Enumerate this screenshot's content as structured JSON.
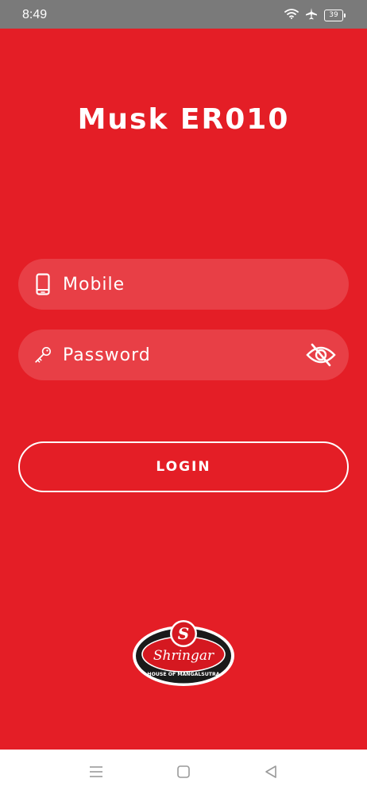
{
  "status_bar": {
    "time": "8:49",
    "battery_level": "39",
    "icons": [
      "wifi-icon",
      "airplane-icon",
      "battery-icon"
    ]
  },
  "app": {
    "title": "Musk ER010"
  },
  "form": {
    "mobile_placeholder": "Mobile",
    "mobile_icon": "phone-icon",
    "password_placeholder": "Password",
    "password_icon": "key-icon",
    "visibility_toggle_icon": "eye-off-icon",
    "login_label": "LOGIN"
  },
  "logo": {
    "brand_name": "Shringar",
    "tagline": "HOUSE OF MANGALSUTRA",
    "monogram": "S"
  },
  "nav_bar": {
    "buttons": [
      "menu-icon",
      "home-square-icon",
      "back-triangle-icon"
    ]
  },
  "colors": {
    "background": "#E41E26",
    "status_bar": "#7A7A7A",
    "text": "#FFFFFF",
    "nav_bar": "#FFFFFF"
  }
}
